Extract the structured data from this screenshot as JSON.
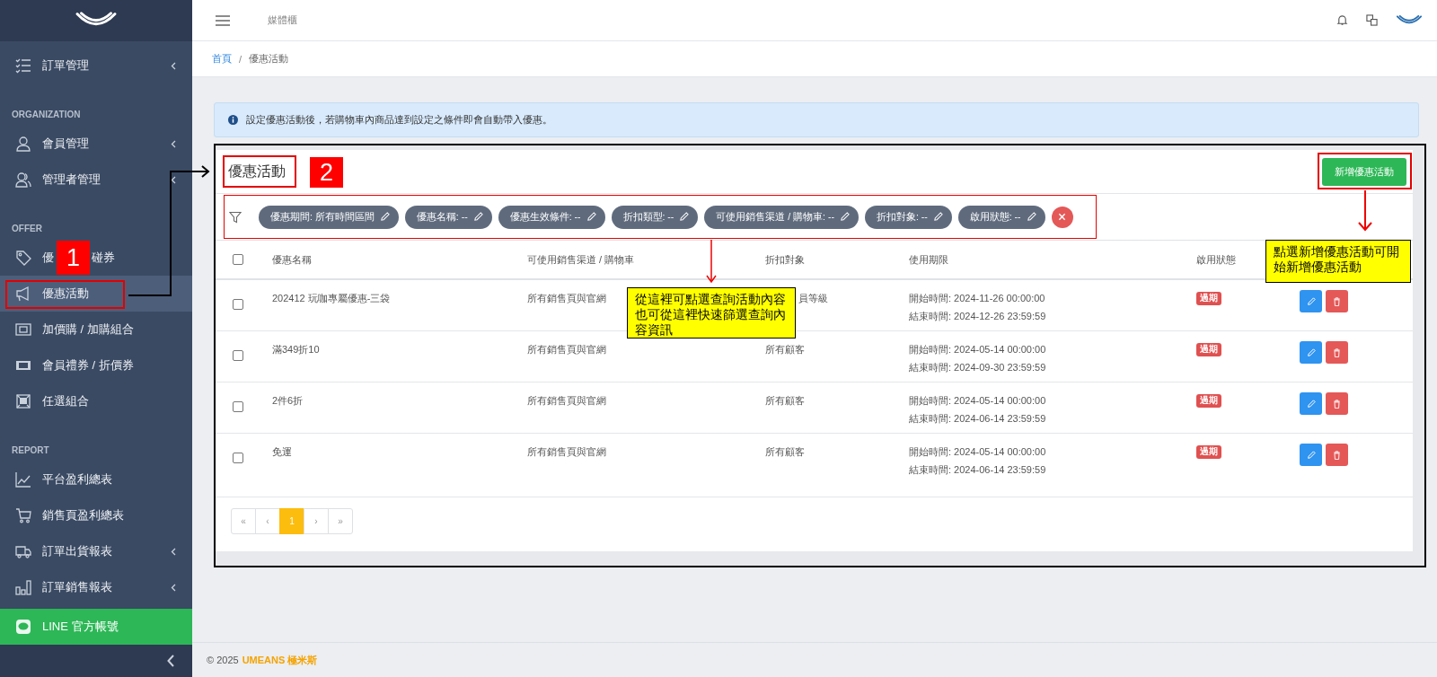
{
  "sidebar": {
    "items": [
      {
        "kind": "item",
        "label": "訂單管理",
        "expandable": true,
        "selected": false
      },
      {
        "kind": "section",
        "label": "ORGANIZATION"
      },
      {
        "kind": "item",
        "label": "會員管理",
        "expandable": true,
        "selected": false
      },
      {
        "kind": "item",
        "label": "管理者管理",
        "expandable": true,
        "selected": false
      },
      {
        "kind": "section",
        "label": "OFFER"
      },
      {
        "kind": "item",
        "label": "優",
        "label_tail": "碰券",
        "expandable": false,
        "selected": false
      },
      {
        "kind": "item",
        "label": "優惠活動",
        "expandable": false,
        "selected": true
      },
      {
        "kind": "item",
        "label": "加價購 / 加購組合",
        "expandable": false,
        "selected": false
      },
      {
        "kind": "item",
        "label": "會員禮券 / 折價券",
        "expandable": false,
        "selected": false
      },
      {
        "kind": "item",
        "label": "任選組合",
        "expandable": false,
        "selected": false
      },
      {
        "kind": "section",
        "label": "REPORT"
      },
      {
        "kind": "item",
        "label": "平台盈利總表",
        "expandable": false,
        "selected": false
      },
      {
        "kind": "item",
        "label": "銷售頁盈利總表",
        "expandable": false,
        "selected": false
      },
      {
        "kind": "item",
        "label": "訂單出貨報表",
        "expandable": true,
        "selected": false
      },
      {
        "kind": "item",
        "label": "訂單銷售報表",
        "expandable": true,
        "selected": false
      },
      {
        "kind": "line",
        "label": "LINE 官方帳號"
      }
    ]
  },
  "topbar": {
    "title": "媒體櫃"
  },
  "breadcrumb": {
    "separator": "/",
    "items": [
      {
        "label": "首頁",
        "link": true
      },
      {
        "label": "優惠活動",
        "link": false
      }
    ]
  },
  "alert": {
    "text": "設定優惠活動後，若購物車內商品達到設定之條件即會自動帶入優惠。"
  },
  "card": {
    "title": "優惠活動",
    "add_button": "新增優惠活動"
  },
  "filters": [
    {
      "label": "優惠期間: 所有時間區間"
    },
    {
      "label": "優惠名稱: --"
    },
    {
      "label": "優惠生效條件: --"
    },
    {
      "label": "折扣類型: --"
    },
    {
      "label": "可使用銷售渠道 / 購物車: --"
    },
    {
      "label": "折扣對象: --"
    },
    {
      "label": "啟用狀態: --"
    }
  ],
  "table": {
    "select_all": {
      "checked": false
    },
    "columns": [
      "優惠名稱",
      "可使用銷售渠道 / 購物車",
      "折扣對象",
      "使用期限",
      "啟用狀態"
    ],
    "rows": [
      {
        "checked": false,
        "name": "202412 玩咖專屬優惠-三袋",
        "channel": "所有銷售頁與官網",
        "target": "員等級",
        "start": "開始時間: 2024-11-26 00:00:00",
        "end": "結束時間: 2024-12-26 23:59:59",
        "status": "過期"
      },
      {
        "checked": false,
        "name": "滿349折10",
        "channel": "所有銷售頁與官網",
        "target": "所有顧客",
        "start": "開始時間: 2024-05-14 00:00:00",
        "end": "結束時間: 2024-09-30 23:59:59",
        "status": "過期"
      },
      {
        "checked": false,
        "name": "2件6折",
        "channel": "所有銷售頁與官網",
        "target": "所有顧客",
        "start": "開始時間: 2024-05-14 00:00:00",
        "end": "結束時間: 2024-06-14 23:59:59",
        "status": "過期"
      },
      {
        "checked": false,
        "name": "免運",
        "channel": "所有銷售頁與官網",
        "target": "所有顧客",
        "start": "開始時間: 2024-05-14 00:00:00",
        "end": "結束時間: 2024-06-14 23:59:59",
        "status": "過期"
      }
    ]
  },
  "pagination": [
    {
      "label": "«",
      "selected": false
    },
    {
      "label": "‹",
      "selected": false
    },
    {
      "label": "1",
      "selected": true
    },
    {
      "label": "›",
      "selected": false
    },
    {
      "label": "»",
      "selected": false
    }
  ],
  "footer": {
    "copyright": "© 2025",
    "brand": "UMEANS 極米斯"
  },
  "annotations": {
    "markers": [
      {
        "text": "1"
      },
      {
        "text": "2"
      }
    ],
    "callouts": [
      {
        "text": "從這裡可點選查詢活動內容也可從這裡快速篩選查詢內容資訊"
      },
      {
        "text": "點選新增優惠活動可開始新增優惠活動"
      }
    ]
  }
}
